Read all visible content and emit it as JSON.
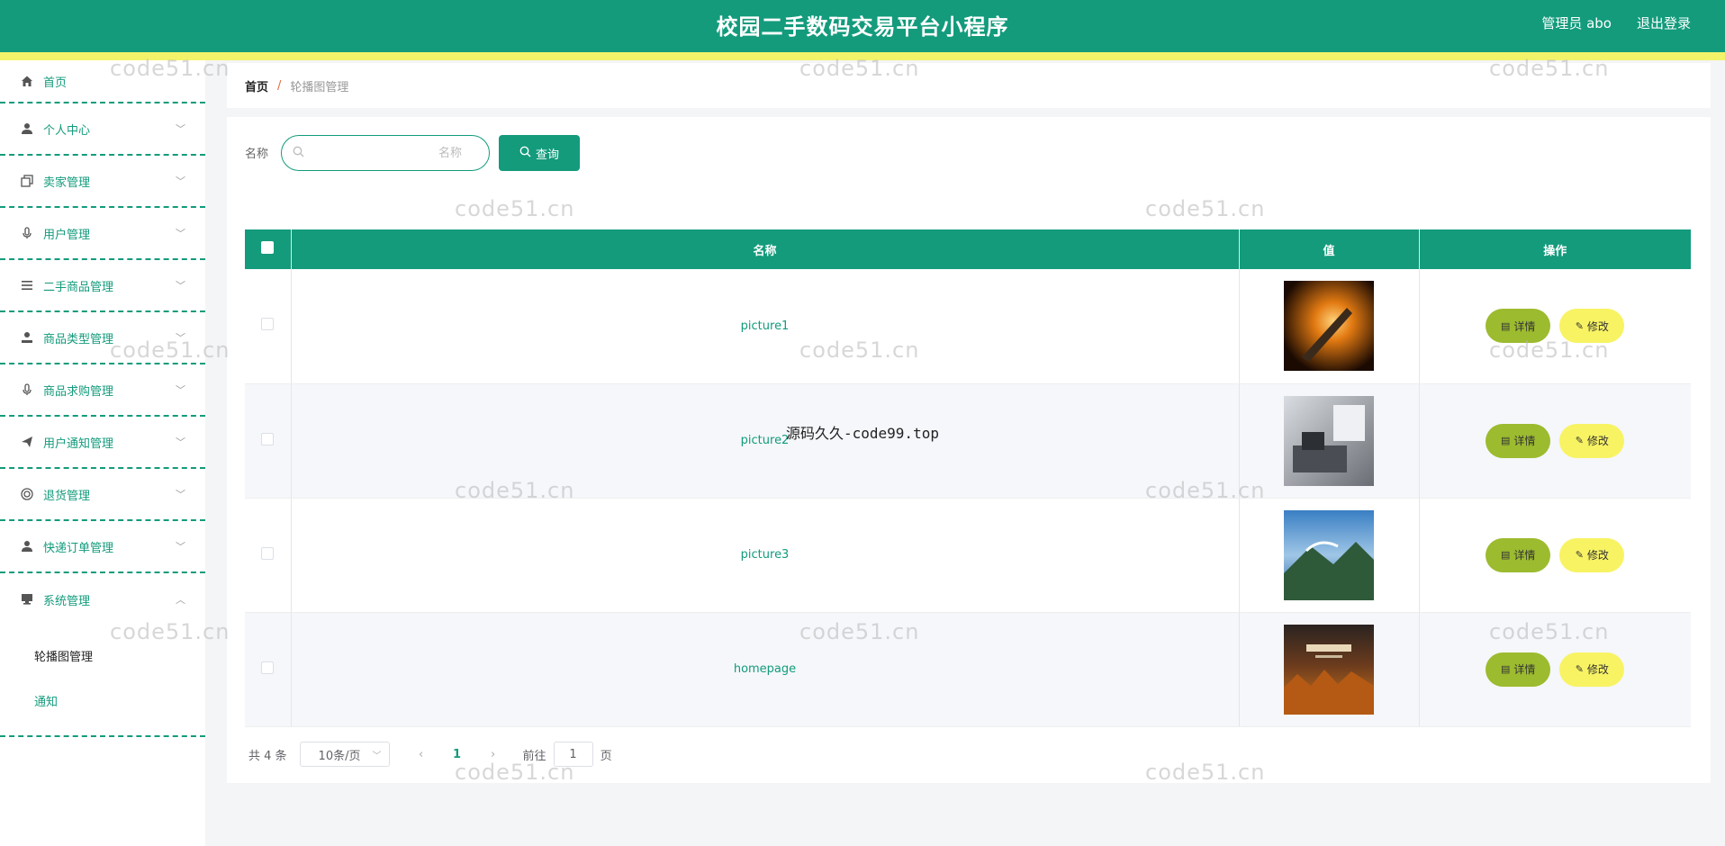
{
  "header": {
    "title": "校园二手数码交易平台小程序",
    "user": "管理员 abo",
    "logout": "退出登录"
  },
  "sidebar": {
    "items": [
      {
        "label": "首页",
        "icon": "home-icon"
      },
      {
        "label": "个人中心",
        "icon": "user-icon"
      },
      {
        "label": "卖家管理",
        "icon": "copy-icon"
      },
      {
        "label": "用户管理",
        "icon": "microphone-icon"
      },
      {
        "label": "二手商品管理",
        "icon": "menu-icon"
      },
      {
        "label": "商品类型管理",
        "icon": "user-icon"
      },
      {
        "label": "商品求购管理",
        "icon": "microphone-icon"
      },
      {
        "label": "用户通知管理",
        "icon": "send-icon"
      },
      {
        "label": "退货管理",
        "icon": "target-icon"
      },
      {
        "label": "快递订单管理",
        "icon": "user-icon"
      },
      {
        "label": "系统管理",
        "icon": "monitor-icon"
      }
    ],
    "submenu": [
      "轮播图管理",
      "通知"
    ]
  },
  "breadcrumb": {
    "home": "首页",
    "separator": "/",
    "current": "轮播图管理"
  },
  "search": {
    "label": "名称",
    "placeholder": "名称",
    "button": "查询"
  },
  "table": {
    "columns": [
      "名称",
      "值",
      "操作"
    ],
    "rows": [
      {
        "name": "picture1",
        "thumb": "orange-spotlight"
      },
      {
        "name": "picture2",
        "thumb": "grey-office"
      },
      {
        "name": "picture3",
        "thumb": "blue-landscape"
      },
      {
        "name": "homepage",
        "thumb": "autumn-poster"
      }
    ],
    "detail_label": "详情",
    "edit_label": "修改"
  },
  "pagination": {
    "total": "共 4 条",
    "page_size": "10条/页",
    "prev": "‹",
    "next": "›",
    "current_page": "1",
    "goto_label": "前往",
    "goto_value": "1",
    "page_suffix": "页"
  },
  "watermark": {
    "text": "code51.cn",
    "center_text": "源码久久-code99.top"
  },
  "colors": {
    "primary": "#139b7c",
    "accent_bar": "#f3f36a",
    "detail_button": "#9cbb2f",
    "edit_button": "#f8f363"
  }
}
